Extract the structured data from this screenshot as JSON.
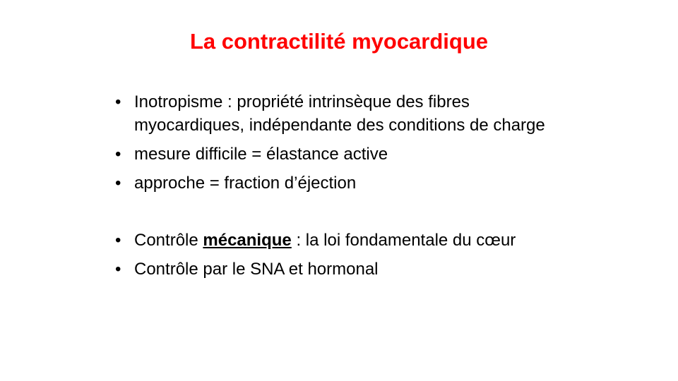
{
  "slide": {
    "title": "La contractilité myocardique",
    "title_color": "#ff0000",
    "bullet_char": "•",
    "bullets": [
      {
        "text": "Inotropisme : propriété intrinsèque des fibres myocardiques, indépendante des conditions de charge"
      },
      {
        "text": "mesure difficile = élastance active"
      },
      {
        "text": "approche = fraction d’éjection"
      },
      {
        "prefix": "Contrôle ",
        "emphasis": "mécanique",
        "suffix": " : la loi fondamentale du cœur"
      },
      {
        "text": "Contrôle par le SNA et hormonal"
      }
    ]
  }
}
